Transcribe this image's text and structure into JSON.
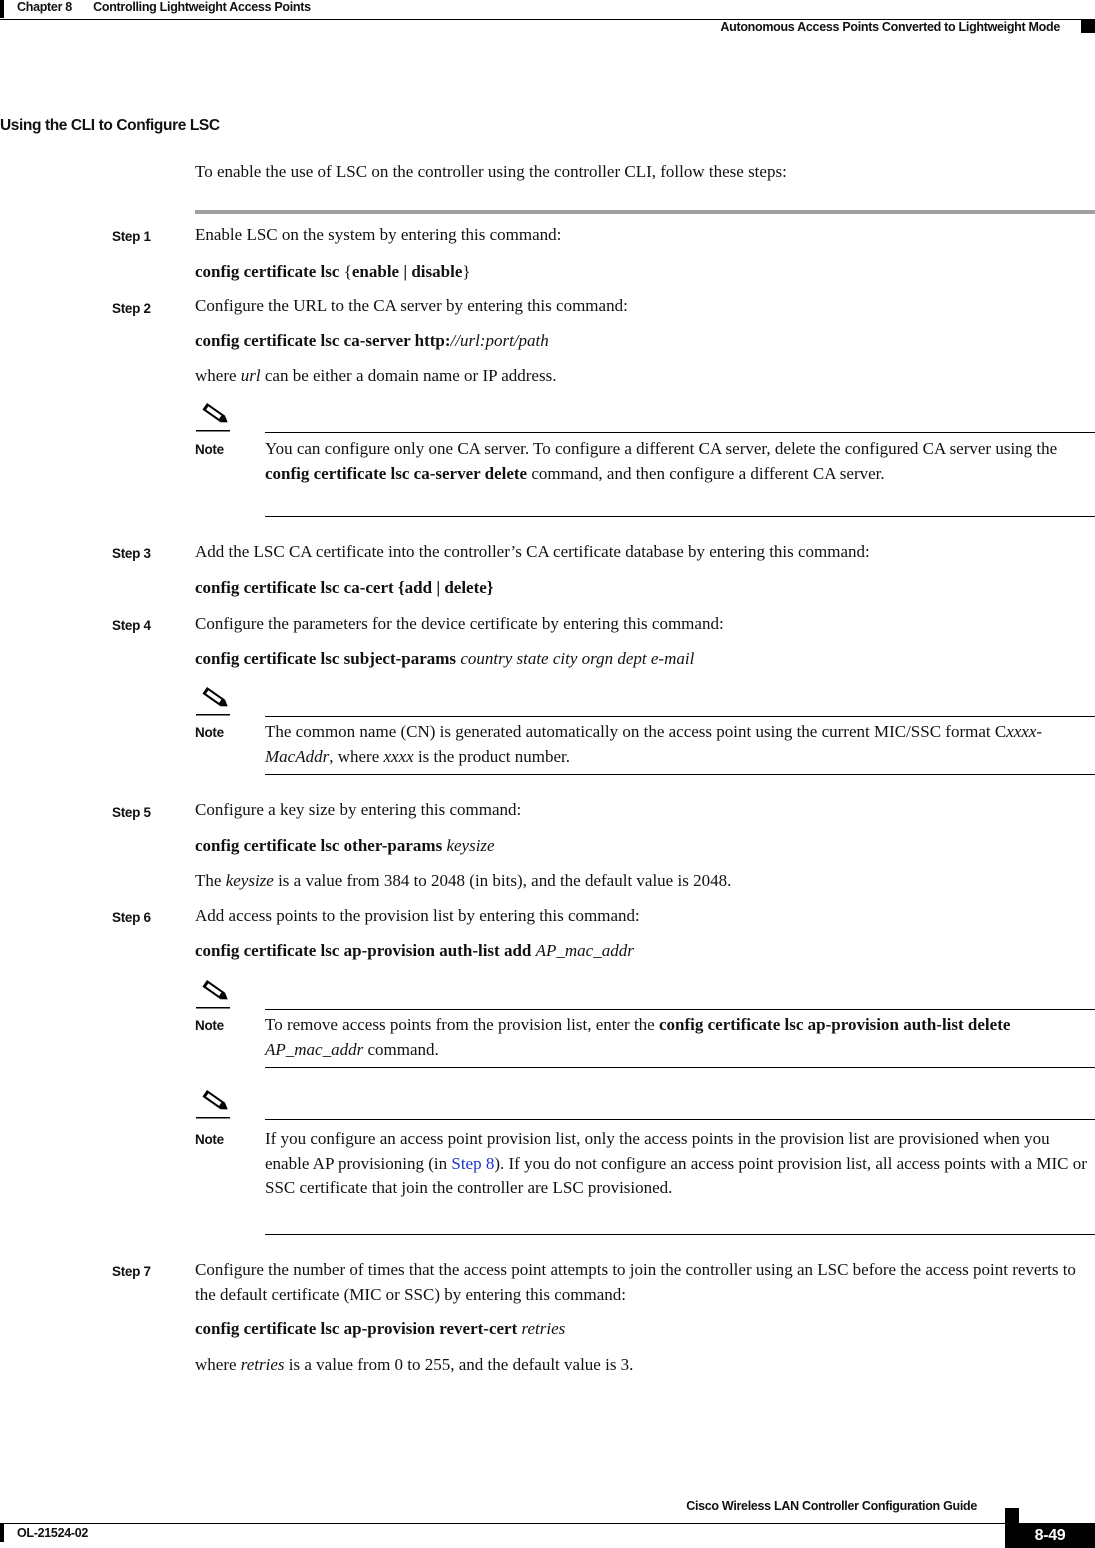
{
  "header": {
    "chapter_num": "Chapter 8",
    "chapter_title": "Controlling Lightweight Access Points",
    "section": "Autonomous Access Points Converted to Lightweight Mode"
  },
  "section_title": "Using the CLI to Configure LSC",
  "intro": "To enable the use of LSC on the controller using the controller CLI, follow these steps:",
  "steps": [
    {
      "label": "Step 1",
      "text": "Enable LSC on the system by entering this command:",
      "command_bold": "config certificate lsc ",
      "command_rest": "{enable | disable}",
      "command_parts": [
        "config certificate lsc {",
        "enable",
        " | ",
        "disable",
        "}"
      ]
    },
    {
      "label": "Step 2",
      "text": "Configure the URL to the CA server by entering this command:",
      "command_bold": "config certificate lsc ca-server http:",
      "command_italic": "//url:port/path",
      "detail_pre": "where ",
      "detail_italic": "url",
      "detail_post": " can be either a domain name or IP address.",
      "note": {
        "label": "Note",
        "pre": "You can configure only one CA server. To configure a different CA server, delete the configured CA server using the ",
        "bold": "config certificate lsc ca-server delete",
        "post": " command, and then configure a different CA server."
      }
    },
    {
      "label": "Step 3",
      "text": "Add the LSC CA certificate into the controller’s CA certificate database by entering this command:",
      "command_parts": [
        "config certificate lsc ca-cert {",
        "add",
        " | ",
        "delete",
        "}"
      ]
    },
    {
      "label": "Step 4",
      "text": "Configure the parameters for the device certificate by entering this command:",
      "command_bold": "config certificate lsc subject-params",
      "command_italic": "country state city orgn dept e-mail",
      "note": {
        "label": "Note",
        "p1": "The common name (CN) is generated automatically on the access point using the current MIC/SSC format C",
        "i1": "xxxx-MacAddr",
        "p2": ", where ",
        "i2": "xxxx",
        "p3": " is the product number."
      }
    },
    {
      "label": "Step 5",
      "text": "Configure a key size by entering this command:",
      "command_bold": "config certificate lsc other-params",
      "command_italic": "keysize",
      "detail_pre": "The ",
      "detail_italic": "keysize",
      "detail_post": " is a value from 384 to 2048 (in bits), and the default value is 2048."
    },
    {
      "label": "Step 6",
      "text": "Add access points to the provision list by entering this command:",
      "command_bold": "config certificate lsc ap-provision auth-list add",
      "command_italic": "AP_mac_addr",
      "note1": {
        "label": "Note",
        "pre": "To remove access points from the provision list, enter the ",
        "bold1": "config certificate lsc ap-provision auth-list delete",
        "italic": "AP_mac_addr",
        "post": " command."
      },
      "note2": {
        "label": "Note",
        "pre": "If you configure an access point provision list, only the access points in the provision list are provisioned when you enable AP provisioning (in ",
        "link": "Step 8",
        "post": "). If you do not configure an access point provision list, all access points with a MIC or SSC certificate that join the controller are LSC provisioned."
      }
    },
    {
      "label": "Step 7",
      "text": "Configure the number of times that the access point attempts to join the controller using an LSC before the access point reverts to the default certificate (MIC or SSC) by entering this command:",
      "command_bold": "config certificate lsc ap-provision revert-cert",
      "command_italic": "retries",
      "detail_pre": "where ",
      "detail_italic": "retries",
      "detail_post": " is a value from 0 to 255, and the default value is 3."
    }
  ],
  "footer": {
    "guide_title": "Cisco Wireless LAN Controller Configuration Guide",
    "doc_number": "OL-21524-02",
    "page_number": "8-49"
  },
  "colors": {
    "link": "#1a35c9",
    "rule_gray": "#a0a0a0"
  }
}
